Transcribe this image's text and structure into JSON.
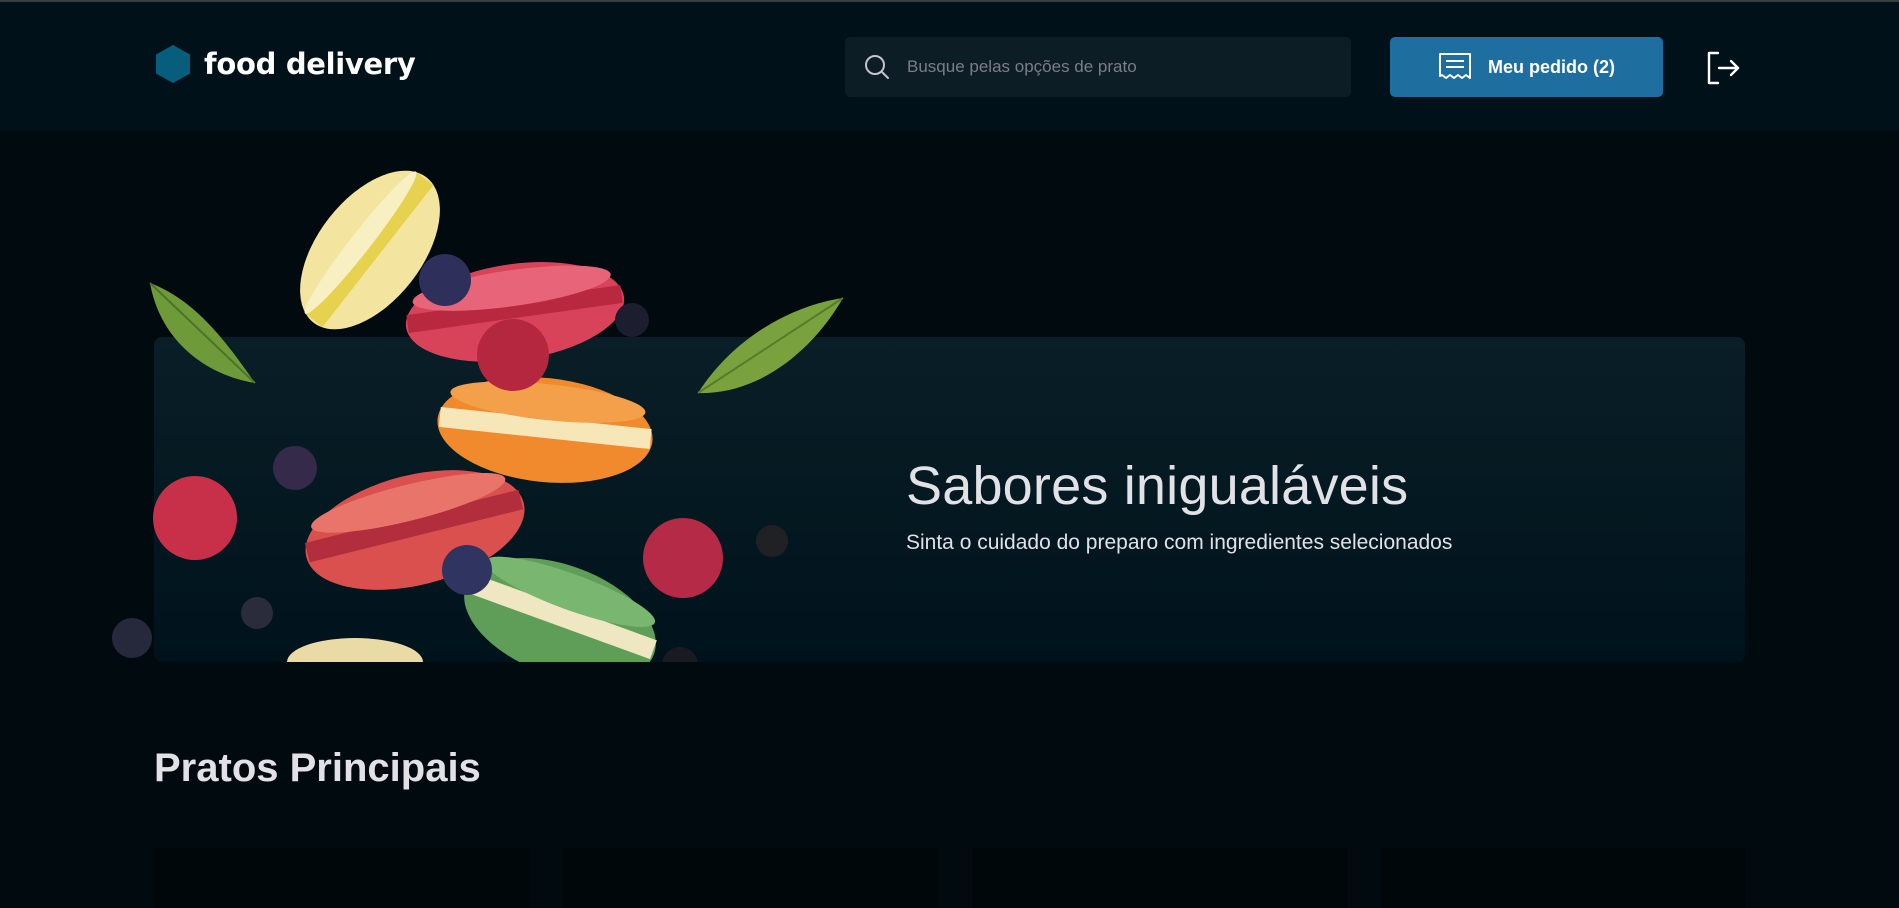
{
  "header": {
    "brand": "food delivery",
    "search": {
      "placeholder": "Busque pelas opções de prato",
      "value": ""
    },
    "order_button": "Meu pedido (2)"
  },
  "banner": {
    "title": "Sabores inigualáveis",
    "subtitle": "Sinta o cuidado do preparo com ingredientes selecionados"
  },
  "sections": [
    {
      "title": "Pratos Principais"
    }
  ],
  "colors": {
    "background": "#000A0F",
    "header": "#00111A",
    "accent": "#1E6F9F",
    "logo": "#065E7C",
    "input_bg": "#0D1D25"
  },
  "icons": [
    "hexagon-logo-icon",
    "search-icon",
    "receipt-icon",
    "sign-out-icon"
  ]
}
